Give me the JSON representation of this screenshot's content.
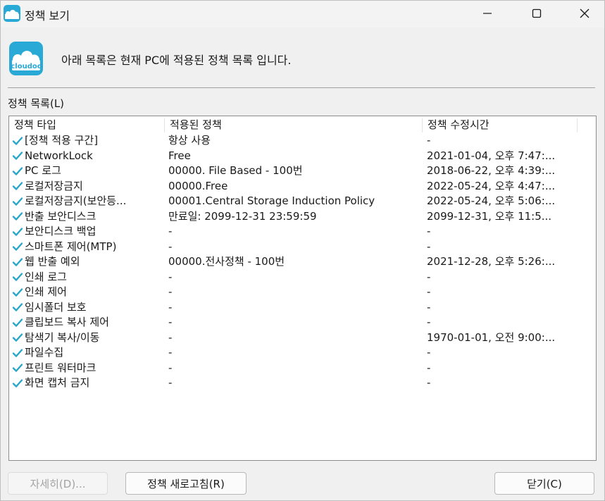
{
  "window": {
    "title": "정책 보기",
    "app_icon_text": "cloudoc"
  },
  "header": {
    "message": "아래 목록은 현재 PC에 적용된 정책 목록 입니다."
  },
  "list": {
    "label": "정책 목록(L)",
    "columns": [
      "정책 타입",
      "적용된 정책",
      "정책 수정시간"
    ],
    "rows": [
      {
        "type": "[정책 적용 구간]",
        "policy": "항상 사용",
        "modified": "-"
      },
      {
        "type": "NetworkLock",
        "policy": "Free",
        "modified": "2021-01-04, 오후 7:47:..."
      },
      {
        "type": "PC 로그",
        "policy": "00000. File Based - 100번",
        "modified": "2018-06-22, 오후 4:39:..."
      },
      {
        "type": "로컬저장금지",
        "policy": "00000.Free",
        "modified": "2022-05-24, 오후 4:47:..."
      },
      {
        "type": "로컬저장금지(보안등...",
        "policy": "00001.Central Storage Induction Policy",
        "modified": "2022-05-24, 오후 5:06:..."
      },
      {
        "type": "반출 보안디스크",
        "policy": "만료일: 2099-12-31 23:59:59",
        "modified": "2099-12-31, 오후 11:5..."
      },
      {
        "type": "보안디스크 백업",
        "policy": "-",
        "modified": "-"
      },
      {
        "type": "스마트폰 제어(MTP)",
        "policy": "-",
        "modified": "-"
      },
      {
        "type": "웹 반출 예외",
        "policy": "00000.전사정책 - 100번",
        "modified": "2021-12-28, 오후 5:26:..."
      },
      {
        "type": "인쇄 로그",
        "policy": "-",
        "modified": "-"
      },
      {
        "type": "인쇄 제어",
        "policy": "-",
        "modified": "-"
      },
      {
        "type": "임시폴더 보호",
        "policy": "-",
        "modified": "-"
      },
      {
        "type": "클립보드 복사 제어",
        "policy": "-",
        "modified": "-"
      },
      {
        "type": "탐색기 복사/이동",
        "policy": "-",
        "modified": "1970-01-01, 오전 9:00:..."
      },
      {
        "type": "파일수집",
        "policy": "-",
        "modified": "-"
      },
      {
        "type": "프린트 워터마크",
        "policy": "-",
        "modified": "-"
      },
      {
        "type": "화면 캡처 금지",
        "policy": "-",
        "modified": "-"
      }
    ]
  },
  "buttons": {
    "detail": "자세히(D)...",
    "refresh": "정책 새로고침(R)",
    "close": "닫기(C)"
  },
  "colors": {
    "check": "#2aa6c9",
    "cloud_bg": "#29a9d6"
  }
}
